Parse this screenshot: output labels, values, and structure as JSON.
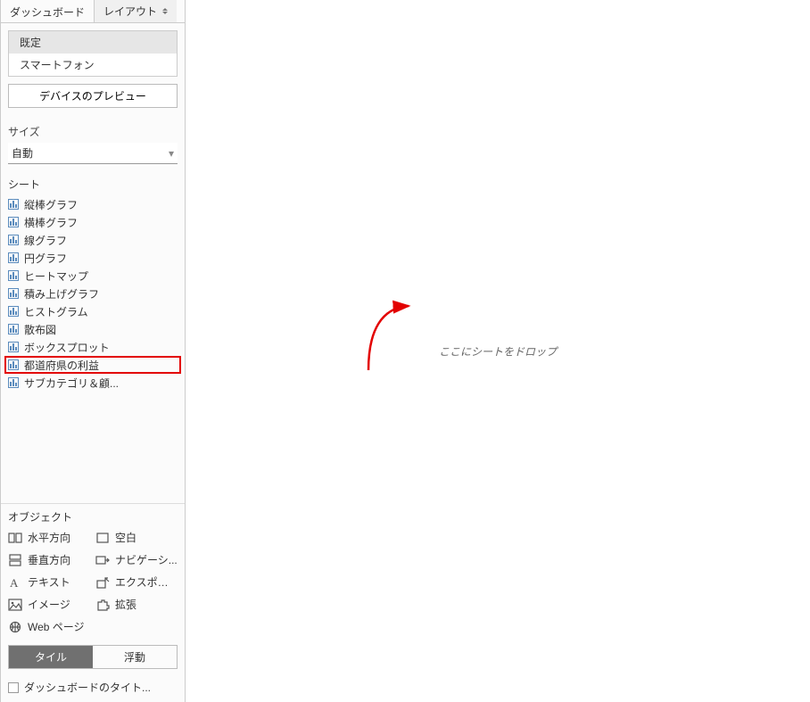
{
  "tabs": {
    "dashboard": "ダッシュボード",
    "layout": "レイアウト"
  },
  "device": {
    "default": "既定",
    "smartphone": "スマートフォン",
    "preview_button": "デバイスのプレビュー"
  },
  "size": {
    "title": "サイズ",
    "selected": "自動"
  },
  "sheets": {
    "title": "シート",
    "items": [
      "縦棒グラフ",
      "横棒グラフ",
      "線グラフ",
      "円グラフ",
      "ヒートマップ",
      "積み上げグラフ",
      "ヒストグラム",
      "散布図",
      "ボックスプロット",
      "都道府県の利益",
      "サブカテゴリ＆顧..."
    ],
    "highlighted_index": 9
  },
  "objects": {
    "title": "オブジェクト",
    "items": [
      {
        "icon": "horizontal-icon",
        "label": "水平方向"
      },
      {
        "icon": "blank-icon",
        "label": "空白"
      },
      {
        "icon": "vertical-icon",
        "label": "垂直方向"
      },
      {
        "icon": "navigation-icon",
        "label": "ナビゲーシ..."
      },
      {
        "icon": "text-icon",
        "label": "テキスト"
      },
      {
        "icon": "export-icon",
        "label": "エクスポート"
      },
      {
        "icon": "image-icon",
        "label": "イメージ"
      },
      {
        "icon": "extension-icon",
        "label": "拡張"
      },
      {
        "icon": "webpage-icon",
        "label": "Web ページ"
      }
    ]
  },
  "layout_toggle": {
    "tile": "タイル",
    "float": "浮動"
  },
  "dashboard_title_checkbox": "ダッシュボードのタイト...",
  "canvas": {
    "drop_hint": "ここにシートをドロップ"
  }
}
